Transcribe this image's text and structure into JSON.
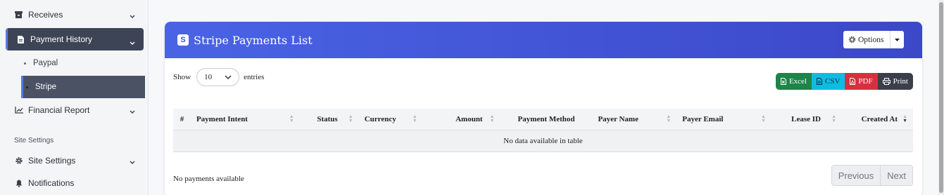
{
  "sidebar": {
    "items": [
      {
        "label": "Receives",
        "icon": "receipt-icon"
      },
      {
        "label": "Payment History",
        "icon": "document-icon",
        "active": true
      },
      {
        "label": "Paypal"
      },
      {
        "label": "Stripe",
        "active": true
      },
      {
        "label": "Financial Report",
        "icon": "chart-line-icon"
      },
      {
        "label": "Site Settings",
        "icon": "gear-icon"
      },
      {
        "label": "Notifications",
        "icon": "bell-icon"
      }
    ],
    "section_heading": "Site Settings"
  },
  "card": {
    "title": "Stripe Payments List",
    "options_label": "Options",
    "header_gradient": [
      "#4a63e5",
      "#3b48c8"
    ]
  },
  "controls": {
    "show_label": "Show",
    "entries_value": "10",
    "entries_label": "entries"
  },
  "exports": {
    "excel": "Excel",
    "csv": "CSV",
    "pdf": "PDF",
    "print": "Print"
  },
  "table": {
    "columns": [
      "#",
      "Payment Intent",
      "Status",
      "Currency",
      "Amount",
      "Payment Method",
      "Payer Name",
      "Payer Email",
      "Lease ID",
      "Created At"
    ],
    "empty_message": "No data available in table"
  },
  "footer": {
    "info": "No payments available",
    "previous": "Previous",
    "next": "Next"
  }
}
